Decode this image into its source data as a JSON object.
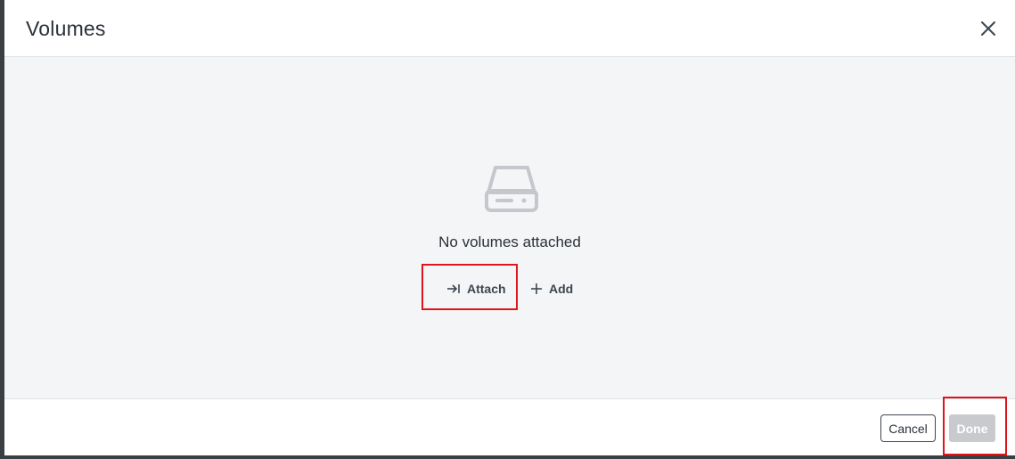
{
  "dialog": {
    "title": "Volumes"
  },
  "empty_state": {
    "icon": "hard-drive-icon",
    "message": "No volumes attached"
  },
  "actions": {
    "attach_label": "Attach",
    "attach_icon": "attach-arrow-icon",
    "add_label": "Add",
    "add_icon": "plus-icon"
  },
  "footer": {
    "cancel_label": "Cancel",
    "done_label": "Done",
    "done_enabled": false
  },
  "colors": {
    "highlight": "#e0141b",
    "body_background": "#f4f5f7",
    "done_disabled": "#c8cacd"
  }
}
